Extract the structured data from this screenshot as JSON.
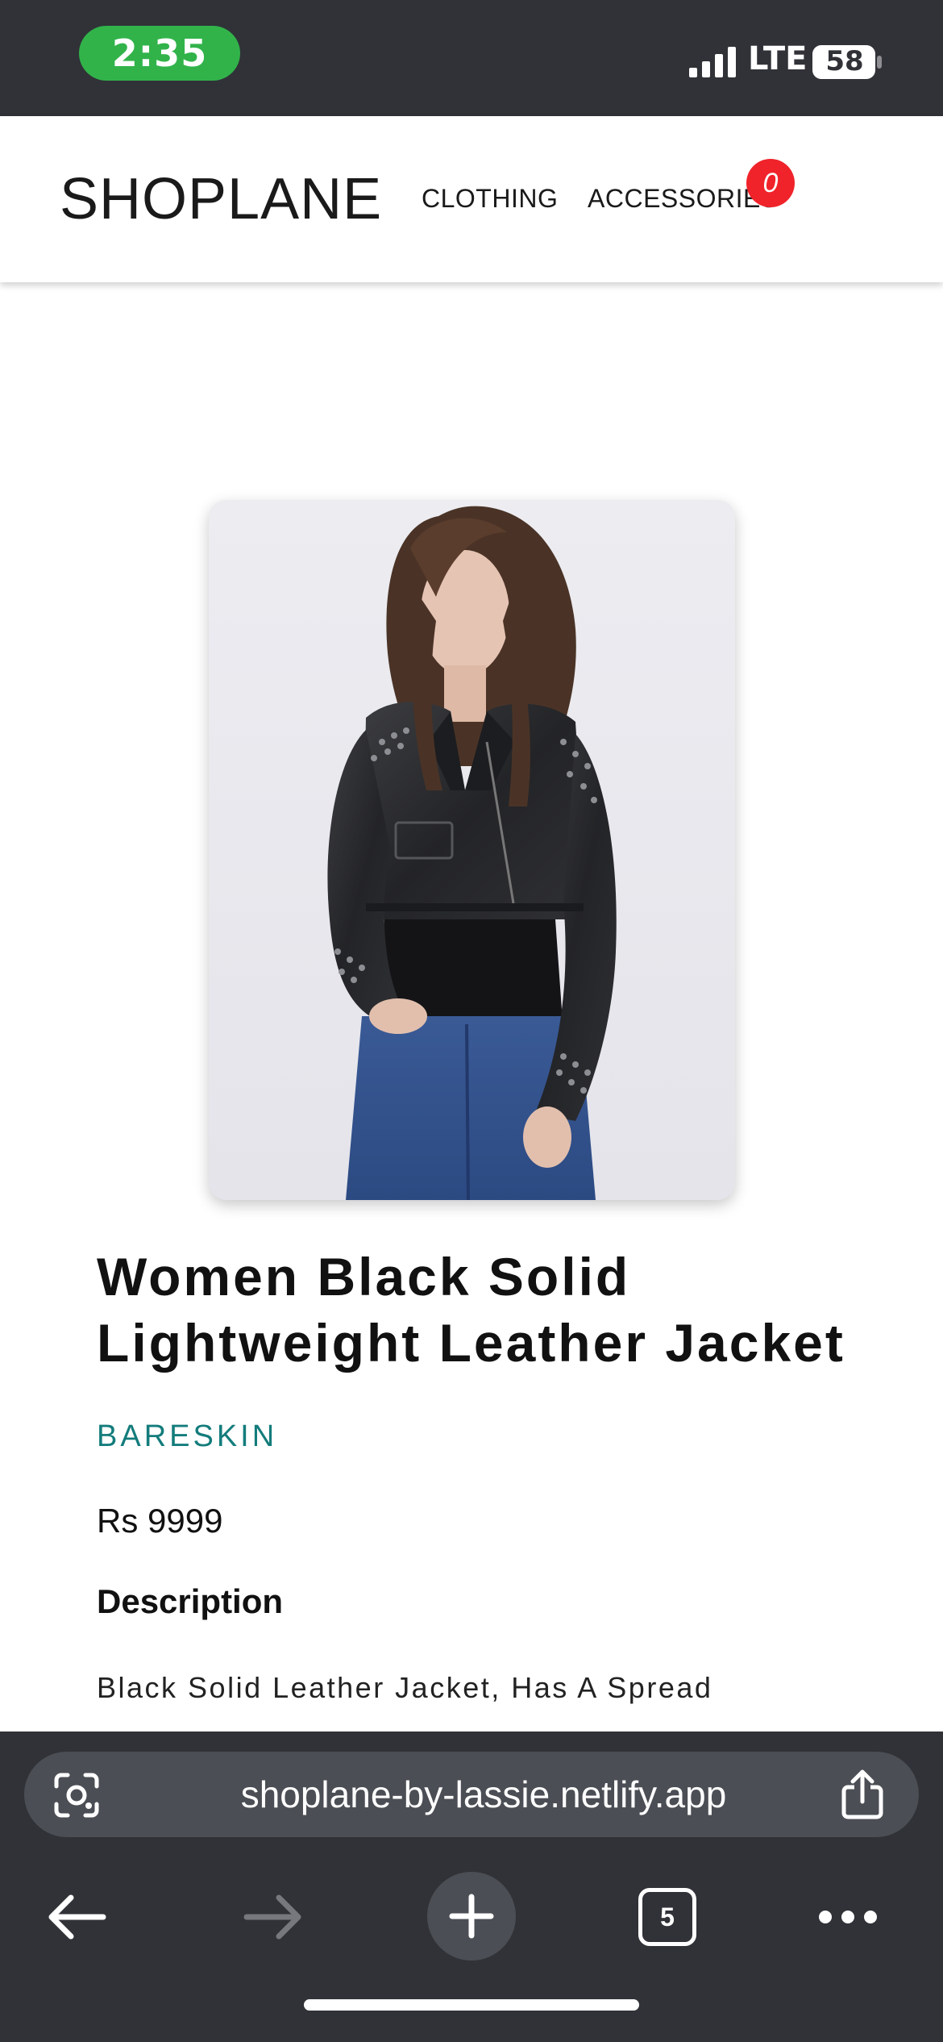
{
  "status_bar": {
    "time": "2:35",
    "network": "LTE",
    "battery": "58"
  },
  "site": {
    "brand": "SHOPLANE",
    "nav": {
      "clothing": "CLOTHING",
      "accessories": "ACCESSORIES"
    },
    "cart_count": "0"
  },
  "product": {
    "image_alt": "Model wearing black studded leather jacket",
    "title": "Women Black Solid Lightweight Leather Jacket",
    "brand": "BARESKIN",
    "price": "Rs 9999",
    "description_heading": "Description",
    "description_text": "Black Solid Leather Jacket, Has A Spread"
  },
  "browser": {
    "url": "shoplane-by-lassie.netlify.app",
    "tab_count": "5"
  },
  "colors": {
    "chrome_dark": "#303237",
    "time_pill": "#31b34a",
    "cart_badge": "#f0232a",
    "brand_teal": "#147c7c"
  }
}
